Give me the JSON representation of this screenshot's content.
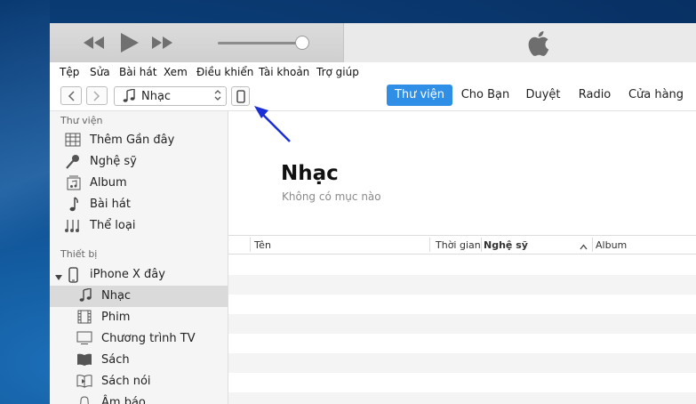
{
  "menu": [
    "Tệp",
    "Sửa",
    "Bài hát",
    "Xem",
    "Điều khiển",
    "Tài khoản",
    "Trợ giúp"
  ],
  "toolbar": {
    "media_selector": "Nhạc",
    "tabs": [
      {
        "label": "Thư viện",
        "active": true
      },
      {
        "label": "Cho Bạn",
        "active": false
      },
      {
        "label": "Duyệt",
        "active": false
      },
      {
        "label": "Radio",
        "active": false
      },
      {
        "label": "Cửa hàng",
        "active": false
      }
    ]
  },
  "sidebar": {
    "library_header": "Thư viện",
    "library_items": [
      {
        "label": "Thêm Gần đây",
        "icon": "grid-icon"
      },
      {
        "label": "Nghệ sỹ",
        "icon": "microphone-icon"
      },
      {
        "label": "Album",
        "icon": "album-icon"
      },
      {
        "label": "Bài hát",
        "icon": "music-note-icon"
      },
      {
        "label": "Thể loại",
        "icon": "genre-icon"
      }
    ],
    "devices_header": "Thiết bị",
    "device_name": "iPhone X đây",
    "device_items": [
      {
        "label": "Nhạc",
        "icon": "music-note-icon",
        "selected": true
      },
      {
        "label": "Phim",
        "icon": "film-icon",
        "selected": false
      },
      {
        "label": "Chương trình TV",
        "icon": "tv-icon",
        "selected": false
      },
      {
        "label": "Sách",
        "icon": "book-icon",
        "selected": false
      },
      {
        "label": "Sách nói",
        "icon": "audiobook-icon",
        "selected": false
      },
      {
        "label": "Âm báo",
        "icon": "bell-icon",
        "selected": false
      }
    ]
  },
  "main": {
    "title": "Nhạc",
    "subtitle": "Không có mục nào",
    "columns": [
      "Tên",
      "Thời gian",
      "Nghệ sỹ",
      "Album"
    ]
  },
  "colors": {
    "accent": "#2f8fe6",
    "annotation_arrow": "#1a2fd6",
    "selected_row": "#dadada"
  }
}
